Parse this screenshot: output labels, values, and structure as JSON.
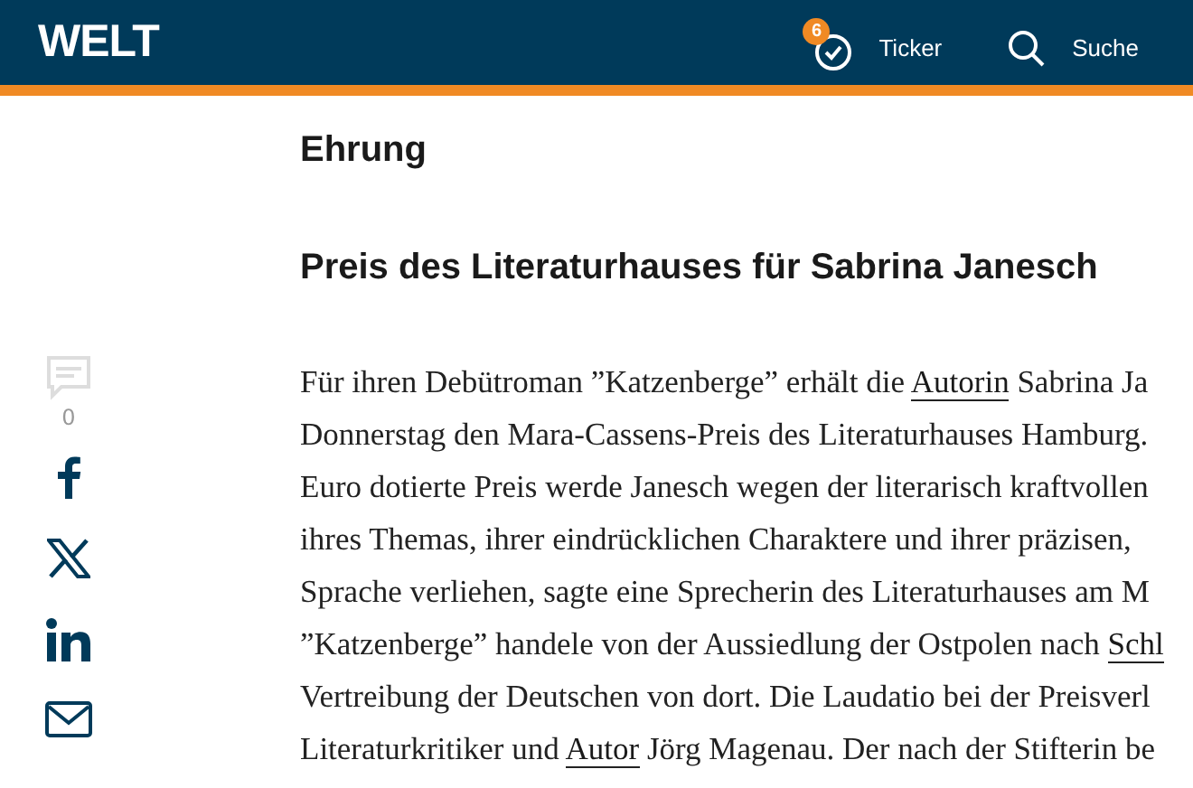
{
  "header": {
    "logo": "WELT",
    "ticker": {
      "label": "Ticker",
      "badge": "6"
    },
    "search": {
      "label": "Suche"
    }
  },
  "share": {
    "comments_count": "0"
  },
  "article": {
    "kicker": "Ehrung",
    "headline": "Preis des Literaturhauses für Sabrina Janesch",
    "lines": [
      [
        {
          "text": "Für ihren Debütroman ”Katzenberge” erhält die ",
          "link": false
        },
        {
          "text": "Autorin",
          "link": true
        },
        {
          "text": " Sabrina Ja",
          "link": false
        }
      ],
      [
        {
          "text": "Donnerstag den Mara-Cassens-Preis des Literaturhauses Hamburg.",
          "link": false
        }
      ],
      [
        {
          "text": "Euro dotierte Preis werde Janesch wegen der literarisch kraftvollen",
          "link": false
        }
      ],
      [
        {
          "text": "ihres Themas, ihrer eindrücklichen Charaktere und ihrer präzisen,",
          "link": false
        }
      ],
      [
        {
          "text": "Sprache verliehen, sagte eine Sprecherin des Literaturhauses am M",
          "link": false
        }
      ],
      [
        {
          "text": "”Katzenberge” handele von der Aussiedlung der Ostpolen nach ",
          "link": false
        },
        {
          "text": "Schl",
          "link": true
        }
      ],
      [
        {
          "text": "Vertreibung der Deutschen von dort. Die Laudatio bei der Preisverl",
          "link": false
        }
      ],
      [
        {
          "text": "Literaturkritiker und ",
          "link": false
        },
        {
          "text": "Autor",
          "link": true
        },
        {
          "text": " Jörg Magenau. Der nach der Stifterin be",
          "link": false
        }
      ]
    ]
  }
}
